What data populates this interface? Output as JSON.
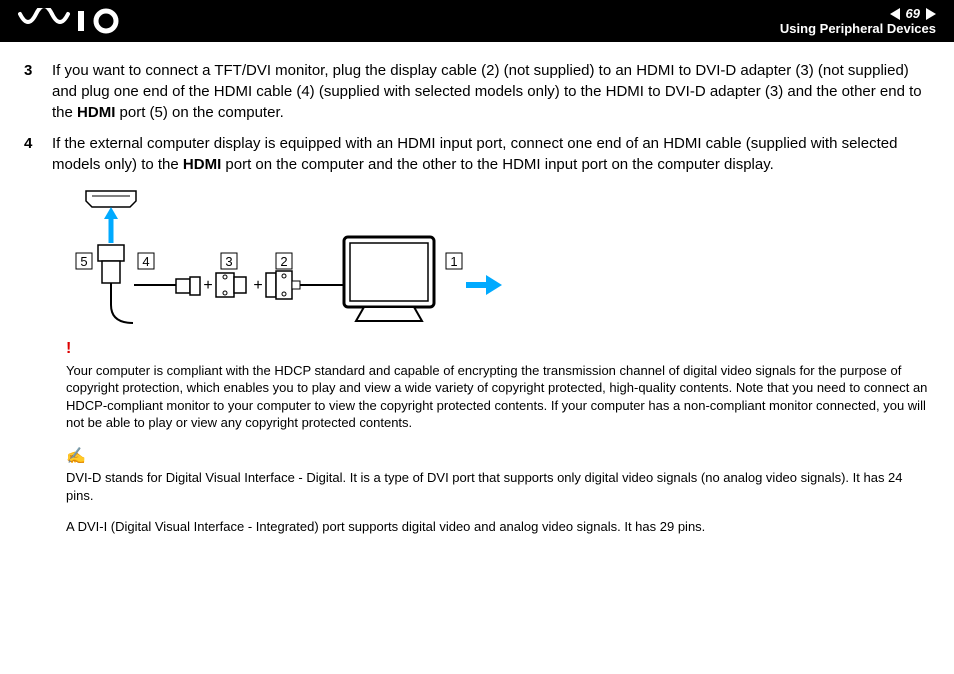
{
  "header": {
    "page_number": "69",
    "section": "Using Peripheral Devices"
  },
  "steps": [
    {
      "num": "3",
      "text_before": "If you want to connect a TFT/DVI monitor, plug the display cable (2) (not supplied) to an HDMI to DVI-D adapter (3) (not supplied) and plug one end of the HDMI cable (4) (supplied with selected models only) to the HDMI to DVI-D adapter (3) and the other end to the ",
      "bold": "HDMI",
      "text_after": " port (5) on the computer."
    },
    {
      "num": "4",
      "text_before": "If the external computer display is equipped with an HDMI input port, connect one end of an HDMI cable (supplied with selected models only) to the ",
      "bold": "HDMI",
      "text_after": " port on the computer and the other to the HDMI input port on the computer display."
    }
  ],
  "diagram": {
    "labels": {
      "1": "1",
      "2": "2",
      "3": "3",
      "4": "4",
      "5": "5"
    }
  },
  "notes": {
    "warn": "Your computer is compliant with the HDCP standard and capable of encrypting the transmission channel of digital video signals for the purpose of copyright protection, which enables you to play and view a wide variety of copyright protected, high-quality contents. Note that you need to connect an HDCP-compliant monitor to your computer to view the copyright protected contents. If your computer has a non-compliant monitor connected, you will not be able to play or view any copyright protected contents.",
    "hint1": "DVI-D stands for Digital Visual Interface - Digital. It is a type of DVI port that supports only digital video signals (no analog video signals). It has 24 pins.",
    "hint2": "A DVI-I (Digital Visual Interface - Integrated) port supports digital video and analog video signals. It has 29 pins."
  }
}
